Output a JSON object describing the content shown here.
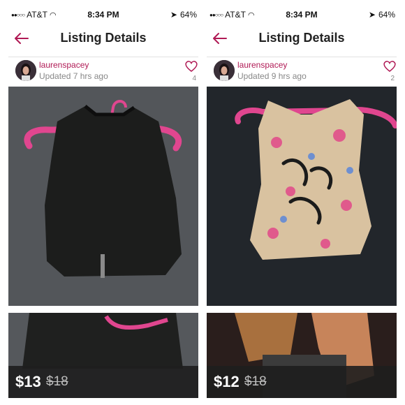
{
  "status": {
    "carrier": "AT&T",
    "time": "8:34 PM",
    "battery": "64%"
  },
  "nav": {
    "title": "Listing Details"
  },
  "listings": [
    {
      "seller": "laurenspacey",
      "updated": "Updated 7 hrs ago",
      "likes": "4",
      "price": "$13",
      "original_price": "$18"
    },
    {
      "seller": "laurenspacey",
      "updated": "Updated 9 hrs ago",
      "likes": "2",
      "price": "$12",
      "original_price": "$18"
    }
  ],
  "colors": {
    "accent": "#b01a55",
    "hanger": "#e84a9f",
    "price_bar": "#1e1e1e"
  },
  "icons": [
    "signal-icon",
    "wifi-icon",
    "location-icon",
    "back-arrow-icon",
    "heart-icon"
  ]
}
